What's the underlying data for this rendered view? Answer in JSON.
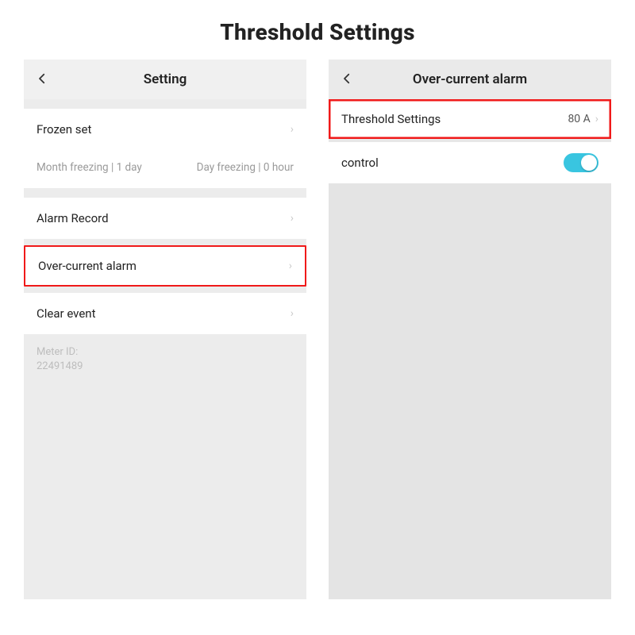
{
  "page_title": "Threshold Settings",
  "left": {
    "nav_title": "Setting",
    "rows": {
      "frozen_set": "Frozen set",
      "alarm_record": "Alarm Record",
      "over_current": "Over-current alarm",
      "clear_event": "Clear event"
    },
    "freeze_info": {
      "month": "Month freezing | 1 day",
      "day": "Day freezing | 0 hour"
    },
    "meter_id_label": "Meter ID:",
    "meter_id_value": "22491489"
  },
  "right": {
    "nav_title": "Over-current alarm",
    "threshold_label": "Threshold Settings",
    "threshold_value": "80 A",
    "control_label": "control",
    "control_on": true
  }
}
